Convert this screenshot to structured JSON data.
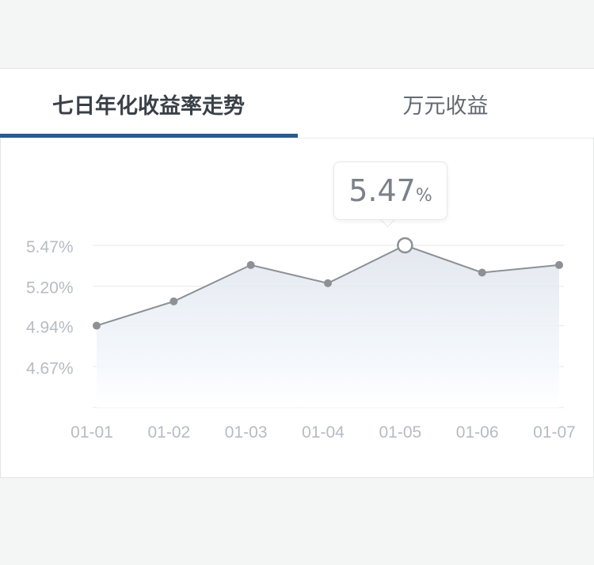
{
  "tabs": [
    {
      "label": "七日年化收益率走势",
      "active": true
    },
    {
      "label": "万元收益",
      "active": false
    }
  ],
  "tooltip": {
    "value": "5.47",
    "unit": "%"
  },
  "colors": {
    "accent": "#2a5b8c",
    "line": "#8d9196",
    "axis_text": "#b6bcc2",
    "grid": "#e6e8ea"
  },
  "chart_data": {
    "type": "area",
    "categories": [
      "01-01",
      "01-02",
      "01-03",
      "01-04",
      "01-05",
      "01-06",
      "01-07"
    ],
    "series": [
      {
        "values": [
          4.94,
          5.1,
          5.34,
          5.22,
          5.47,
          5.29,
          5.34
        ]
      }
    ],
    "y_ticks": [
      "5.47%",
      "5.20%",
      "4.94%",
      "4.67%"
    ],
    "y_tick_values": [
      5.47,
      5.2,
      4.94,
      4.67
    ],
    "ylim": [
      4.4,
      5.47
    ],
    "highlight_index": 4,
    "grid": true
  }
}
